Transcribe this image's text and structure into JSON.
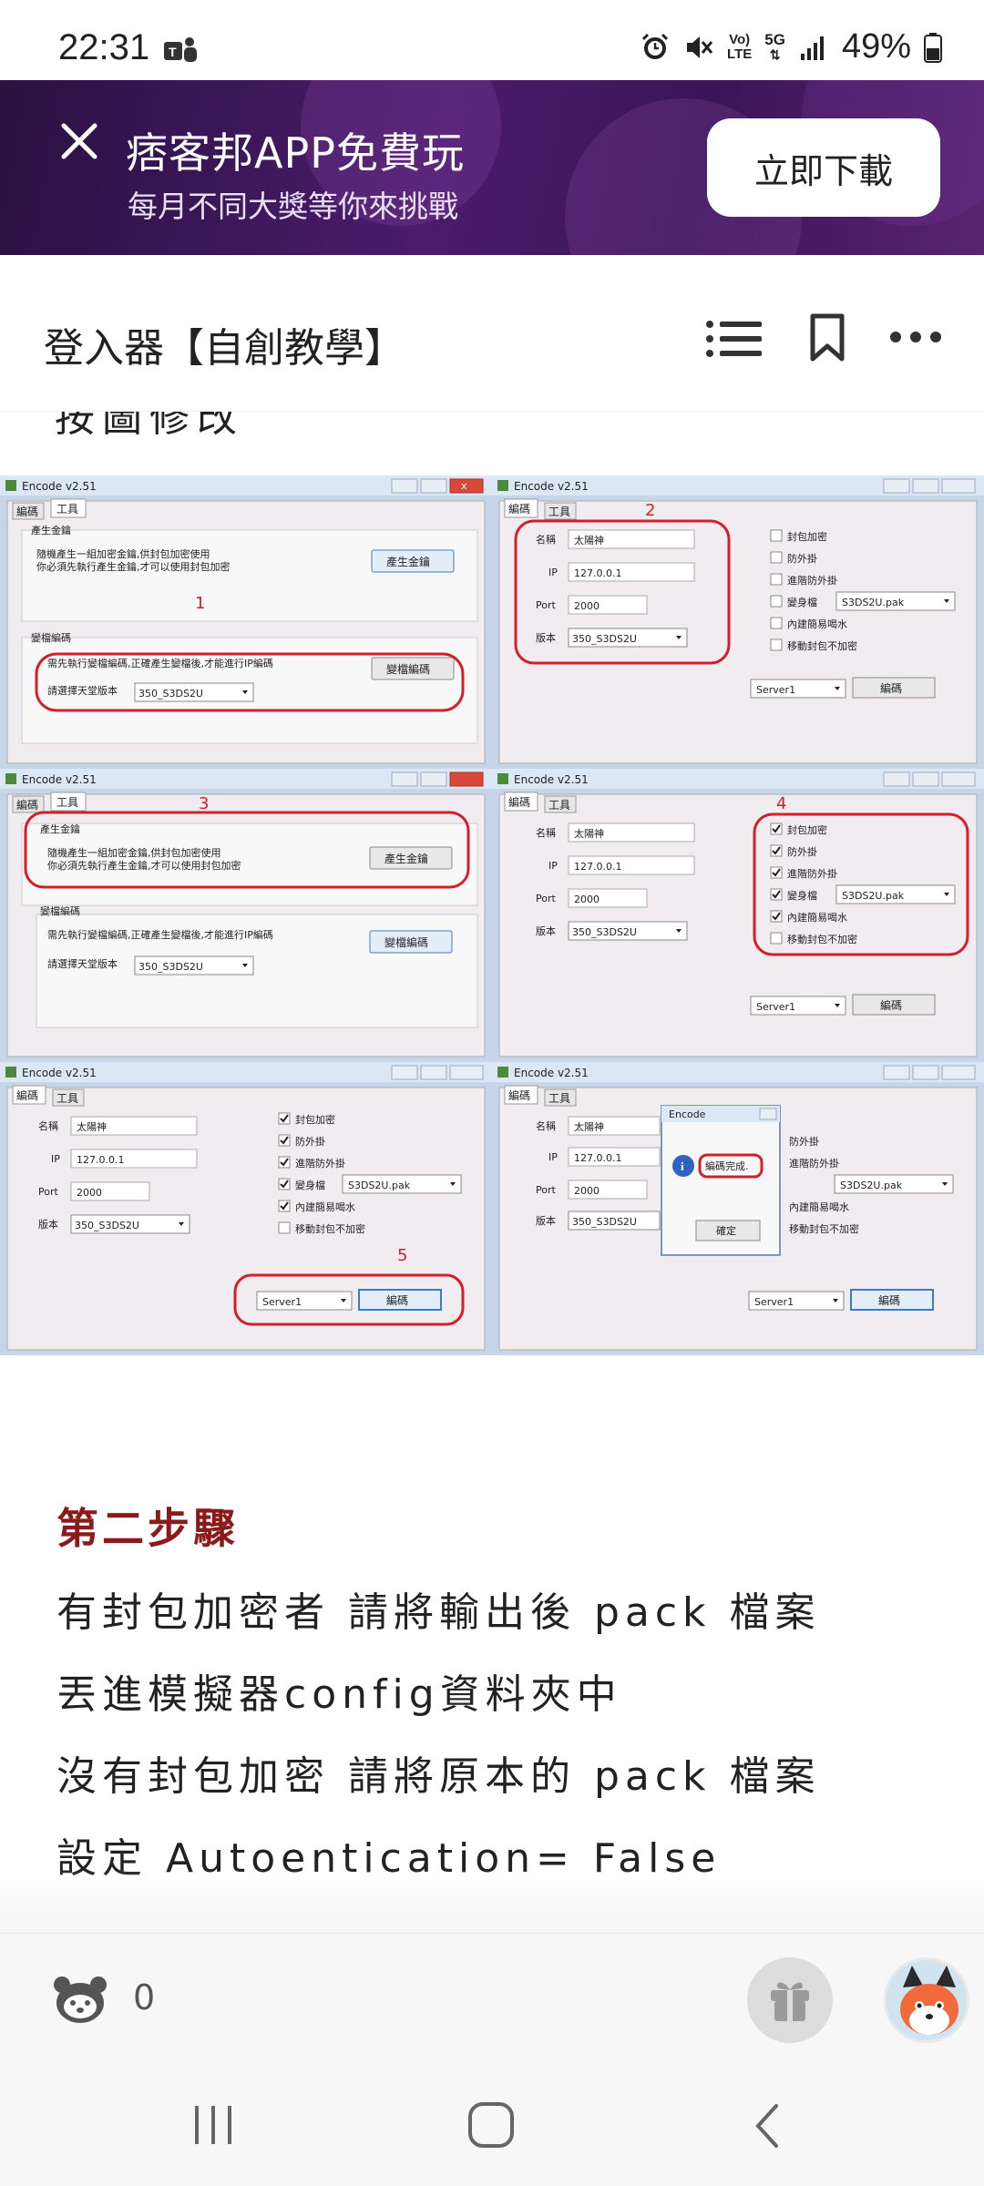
{
  "status": {
    "time": "22:31",
    "battery": "49%",
    "net_top": "Vo)",
    "net_mid": "LTE",
    "gen": "5G"
  },
  "ad": {
    "title": "痞客邦APP免費玩",
    "subtitle": "每月不同大獎等你來挑戰",
    "download": "立即下載"
  },
  "header": {
    "title": "登入器【自創教學】"
  },
  "article": {
    "cut_text": "按圖修改",
    "section_title": "第二步驟",
    "lines": [
      "有封包加密者 請將輸出後 pack 檔案",
      "丟進模擬器config資料夾中",
      "沒有封包加密 請將原本的 pack 檔案",
      "設定 Autoentication= False"
    ]
  },
  "screens": {
    "window_title": "Encode v2.51",
    "tab_encode": "編碼",
    "tab_tools": "工具",
    "gen_group": "產生金鑰",
    "gen_desc1": "隨機產生一組加密金鑰,供封包加密使用",
    "gen_desc2": "你必須先執行產生金鑰,才可以使用封包加密",
    "gen_btn": "產生金鑰",
    "enc_group": "變檔編碼",
    "enc_desc": "需先執行變檔編碼,正確產生變檔後,才能進行IP編碼",
    "enc_btn": "變檔編碼",
    "select_label": "請選擇天堂版本",
    "select_value": "350_S3DS2U",
    "name_label": "名稱",
    "name_value": "太陽神",
    "ip_label": "IP",
    "ip_value": "127.0.0.1",
    "port_label": "Port",
    "port_value": "2000",
    "ver_label": "版本",
    "cb_pack": "封包加密",
    "cb_hack": "防外掛",
    "cb_adv": "進階防外掛",
    "cb_morph": "變身檔",
    "cb_water": "內建簡易喝水",
    "cb_move": "移動封包不加密",
    "morph_value": "S3DS2U.pak",
    "server_value": "Server1",
    "encode_btn": "編碼",
    "dialog_title": "Encode",
    "dialog_msg": "編碼完成.",
    "dialog_ok": "確定",
    "step1": "1",
    "step2": "2",
    "step3": "3",
    "step4": "4",
    "step5": "5"
  },
  "bottom": {
    "like_count": "0"
  },
  "colors": {
    "accent": "#8b1a1a",
    "ad_bg": "#3a1458",
    "annotation": "#d21f2a"
  }
}
